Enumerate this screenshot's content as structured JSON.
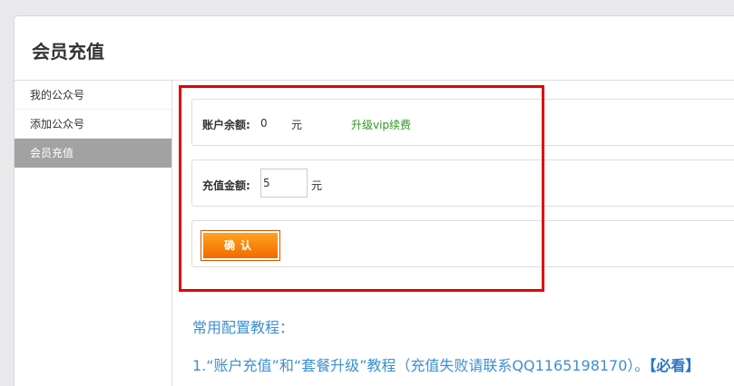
{
  "header": {
    "title": "会员充值"
  },
  "sidebar": {
    "items": [
      {
        "label": "我的公众号"
      },
      {
        "label": "添加公众号"
      },
      {
        "label": "会员充值"
      }
    ]
  },
  "balance": {
    "label": "账户余额:",
    "value": "0",
    "unit": "元",
    "upgrade_link": "升级vip续费"
  },
  "recharge": {
    "label": "充值金额:",
    "amount": "5",
    "unit": "元"
  },
  "actions": {
    "confirm_label": "确认"
  },
  "tutorials": {
    "heading": "常用配置教程：",
    "items": [
      {
        "text": "1.“账户充值”和“套餐升级”教程（充值失败请联系QQ1165198170）。",
        "tag": "【必看】"
      }
    ]
  },
  "colors": {
    "accent_orange": "#f26a00",
    "highlight_red": "#e40000",
    "link_green": "#2a9a1f",
    "link_blue": "#3d8fd2",
    "active_sidebar": "#a2a2a2"
  }
}
